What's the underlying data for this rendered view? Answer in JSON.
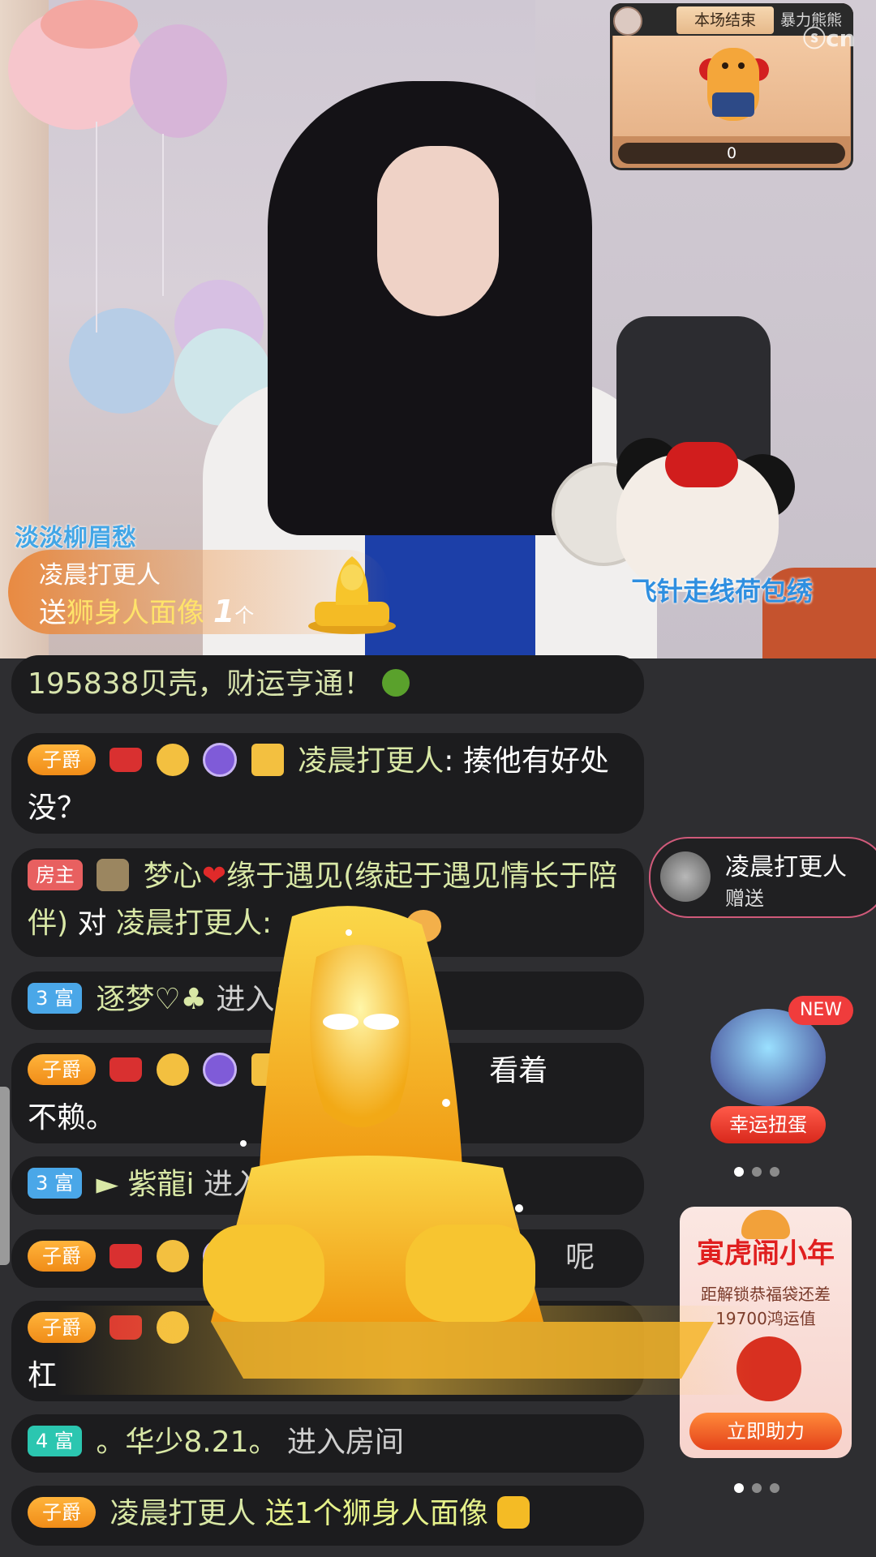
{
  "video": {
    "streamer_name": "淡淡柳眉愁",
    "fanclub_label": "飞针走线荷包绣",
    "watermark": "ⓢcn"
  },
  "gift_popup": {
    "sender": "凌晨打更人",
    "prefix": "送",
    "gift_name": "狮身人面像",
    "count": "1",
    "unit": "个"
  },
  "game_widget": {
    "tab_ended": "本场结束",
    "tab_name": "暴力熊熊",
    "score": "0"
  },
  "chat": {
    "messages": [
      {
        "text": "195838贝壳，财运亨通！"
      },
      {
        "badge": "子爵",
        "user": "凌晨打更人",
        "text": "揍他有好处没？"
      },
      {
        "badge": "房主",
        "user": "梦心",
        "heart": "❤",
        "user2": "缘于遇见(缘起于遇见情长于陪伴)",
        "mid": " 对 ",
        "target": "凌晨打更人:"
      },
      {
        "badge": "3 富",
        "user": "逐梦♡♣",
        "text": "进入房间"
      },
      {
        "badge": "子爵",
        "user": "凌",
        "text": "看着",
        "text2": "不赖。"
      },
      {
        "badge": "3 富",
        "user": "► 紫龍i",
        "text": "进入房"
      },
      {
        "badge": "子爵",
        "text": "呢"
      },
      {
        "badge": "子爵",
        "text": "杠"
      },
      {
        "badge": "4 富",
        "user": "。华少8.21。",
        "text": "进入房间"
      },
      {
        "badge": "子爵",
        "user": "凌晨打更人",
        "text": "送1个狮身人面像"
      }
    ]
  },
  "sender_card": {
    "name": "凌晨打更人",
    "action": "赠送"
  },
  "capsule": {
    "new_label": "NEW",
    "label": "幸运扭蛋"
  },
  "tiger_event": {
    "title": "寅虎闹小年",
    "line1": "距解锁恭福袋还差",
    "line2": "19700鸿运值",
    "button": "立即助力"
  },
  "colors": {
    "chat_name": "#d9e8a6",
    "badge_zijue": "#f6a428",
    "badge_fangzhu": "#e86060",
    "badge_fu3": "#4aa7e8",
    "badge_fu4": "#2bc6b0",
    "accent_red": "#e01f1f"
  },
  "icons": [
    "crown-icon",
    "star-level-icon",
    "medal-icon",
    "user-square-icon",
    "wing-badge-icon",
    "go-arrow-icon",
    "sphinx-gift-icon"
  ]
}
